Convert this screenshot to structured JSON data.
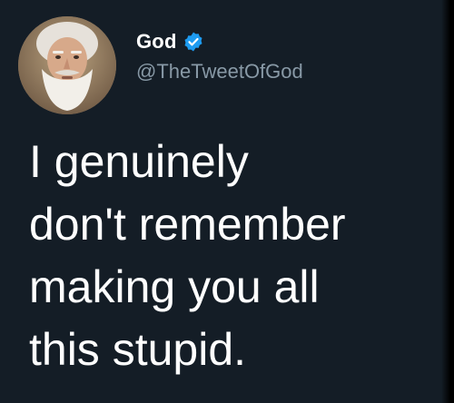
{
  "tweet": {
    "author": {
      "display_name": "God",
      "handle": "@TheTweetOfGod",
      "verified": true,
      "avatar_icon": "bearded-man-avatar"
    },
    "text_lines": [
      "I genuinely",
      "don't remember",
      "making you all",
      "this stupid."
    ]
  },
  "colors": {
    "background": "#141d26",
    "text": "#ffffff",
    "handle": "#8899a6",
    "verified_badge": "#1d9bf0"
  }
}
